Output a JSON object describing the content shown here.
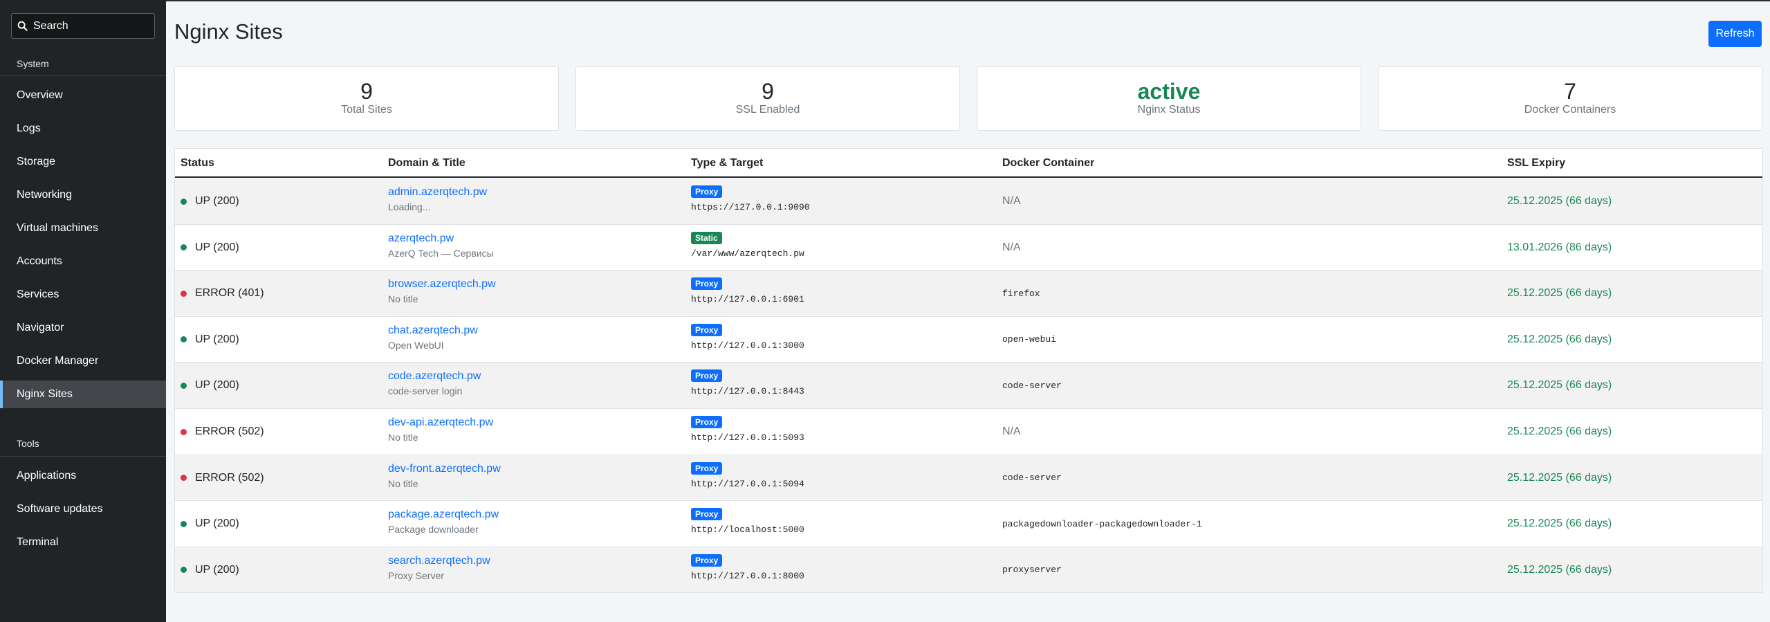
{
  "sidebar": {
    "search_label": "Search",
    "section_system": "System",
    "system_items": [
      "Overview",
      "Logs",
      "Storage",
      "Networking",
      "Virtual machines",
      "Accounts",
      "Services",
      "Navigator",
      "Docker Manager",
      "Nginx Sites"
    ],
    "active_item": "Nginx Sites",
    "section_tools": "Tools",
    "tools_items": [
      "Applications",
      "Software updates",
      "Terminal"
    ]
  },
  "header": {
    "title": "Nginx Sites",
    "refresh_label": "Refresh"
  },
  "stats": [
    {
      "value": "9",
      "label": "Total Sites"
    },
    {
      "value": "9",
      "label": "SSL Enabled"
    },
    {
      "value": "active",
      "label": "Nginx Status"
    },
    {
      "value": "7",
      "label": "Docker Containers"
    }
  ],
  "table": {
    "columns": [
      "Status",
      "Domain & Title",
      "Type & Target",
      "Docker Container",
      "SSL Expiry"
    ],
    "rows": [
      {
        "status": "UP (200)",
        "state": "up",
        "domain": "admin.azerqtech.pw",
        "title": "Loading...",
        "type": "Proxy",
        "target": "https://127.0.0.1:9090",
        "docker": "N/A",
        "ssl": "25.12.2025 (66 days)"
      },
      {
        "status": "UP (200)",
        "state": "up",
        "domain": "azerqtech.pw",
        "title": "AzerQ Tech — Сервисы",
        "type": "Static",
        "target": "/var/www/azerqtech.pw",
        "docker": "N/A",
        "ssl": "13.01.2026 (86 days)"
      },
      {
        "status": "ERROR (401)",
        "state": "error",
        "domain": "browser.azerqtech.pw",
        "title": "No title",
        "type": "Proxy",
        "target": "http://127.0.0.1:6901",
        "docker": "firefox",
        "ssl": "25.12.2025 (66 days)"
      },
      {
        "status": "UP (200)",
        "state": "up",
        "domain": "chat.azerqtech.pw",
        "title": "Open WebUI",
        "type": "Proxy",
        "target": "http://127.0.0.1:3000",
        "docker": "open-webui",
        "ssl": "25.12.2025 (66 days)"
      },
      {
        "status": "UP (200)",
        "state": "up",
        "domain": "code.azerqtech.pw",
        "title": "code-server login",
        "type": "Proxy",
        "target": "http://127.0.0.1:8443",
        "docker": "code-server",
        "ssl": "25.12.2025 (66 days)"
      },
      {
        "status": "ERROR (502)",
        "state": "error",
        "domain": "dev-api.azerqtech.pw",
        "title": "No title",
        "type": "Proxy",
        "target": "http://127.0.0.1:5093",
        "docker": "N/A",
        "ssl": "25.12.2025 (66 days)"
      },
      {
        "status": "ERROR (502)",
        "state": "error",
        "domain": "dev-front.azerqtech.pw",
        "title": "No title",
        "type": "Proxy",
        "target": "http://127.0.0.1:5094",
        "docker": "code-server",
        "ssl": "25.12.2025 (66 days)"
      },
      {
        "status": "UP (200)",
        "state": "up",
        "domain": "package.azerqtech.pw",
        "title": "Package downloader",
        "type": "Proxy",
        "target": "http://localhost:5000",
        "docker": "packagedownloader-packagedownloader-1",
        "ssl": "25.12.2025 (66 days)"
      },
      {
        "status": "UP (200)",
        "state": "up",
        "domain": "search.azerqtech.pw",
        "title": "Proxy Server",
        "type": "Proxy",
        "target": "http://127.0.0.1:8000",
        "docker": "proxyserver",
        "ssl": "25.12.2025 (66 days)"
      }
    ]
  },
  "colors": {
    "accent": "#0d6efd",
    "success": "#198754",
    "danger": "#dc3545",
    "sidebar_bg": "#212427"
  }
}
